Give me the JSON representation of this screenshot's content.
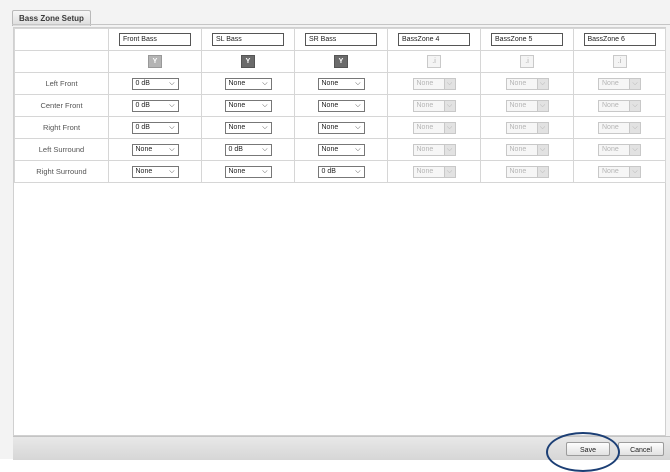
{
  "window": {
    "title": "Bass Zone Setup"
  },
  "zones": [
    {
      "name": "Front Bass",
      "y_label": "Y",
      "y_state": "light",
      "enabled": true
    },
    {
      "name": "SL Bass",
      "y_label": "Y",
      "y_state": "dark",
      "enabled": true
    },
    {
      "name": "SR Bass",
      "y_label": "Y",
      "y_state": "dark",
      "enabled": true
    },
    {
      "name": "BassZone 4",
      "y_label": ".i",
      "y_state": "off",
      "enabled": false
    },
    {
      "name": "BassZone 5",
      "y_label": ".i",
      "y_state": "off",
      "enabled": false
    },
    {
      "name": "BassZone 6",
      "y_label": ".i",
      "y_state": "off",
      "enabled": false
    }
  ],
  "rows": [
    {
      "label": "Left Front",
      "values": [
        "0 dB",
        "None",
        "None",
        "None",
        "None",
        "None"
      ]
    },
    {
      "label": "Center Front",
      "values": [
        "0 dB",
        "None",
        "None",
        "None",
        "None",
        "None"
      ]
    },
    {
      "label": "Right Front",
      "values": [
        "0 dB",
        "None",
        "None",
        "None",
        "None",
        "None"
      ]
    },
    {
      "label": "Left Surround",
      "values": [
        "None",
        "0 dB",
        "None",
        "None",
        "None",
        "None"
      ]
    },
    {
      "label": "Right Surround",
      "values": [
        "None",
        "None",
        "0 dB",
        "None",
        "None",
        "None"
      ]
    }
  ],
  "chevron_glyph": "⌵",
  "footer": {
    "save_label": "Save",
    "cancel_label": "Cancel"
  },
  "colors": {
    "highlight_ring": "#1c3f75"
  }
}
